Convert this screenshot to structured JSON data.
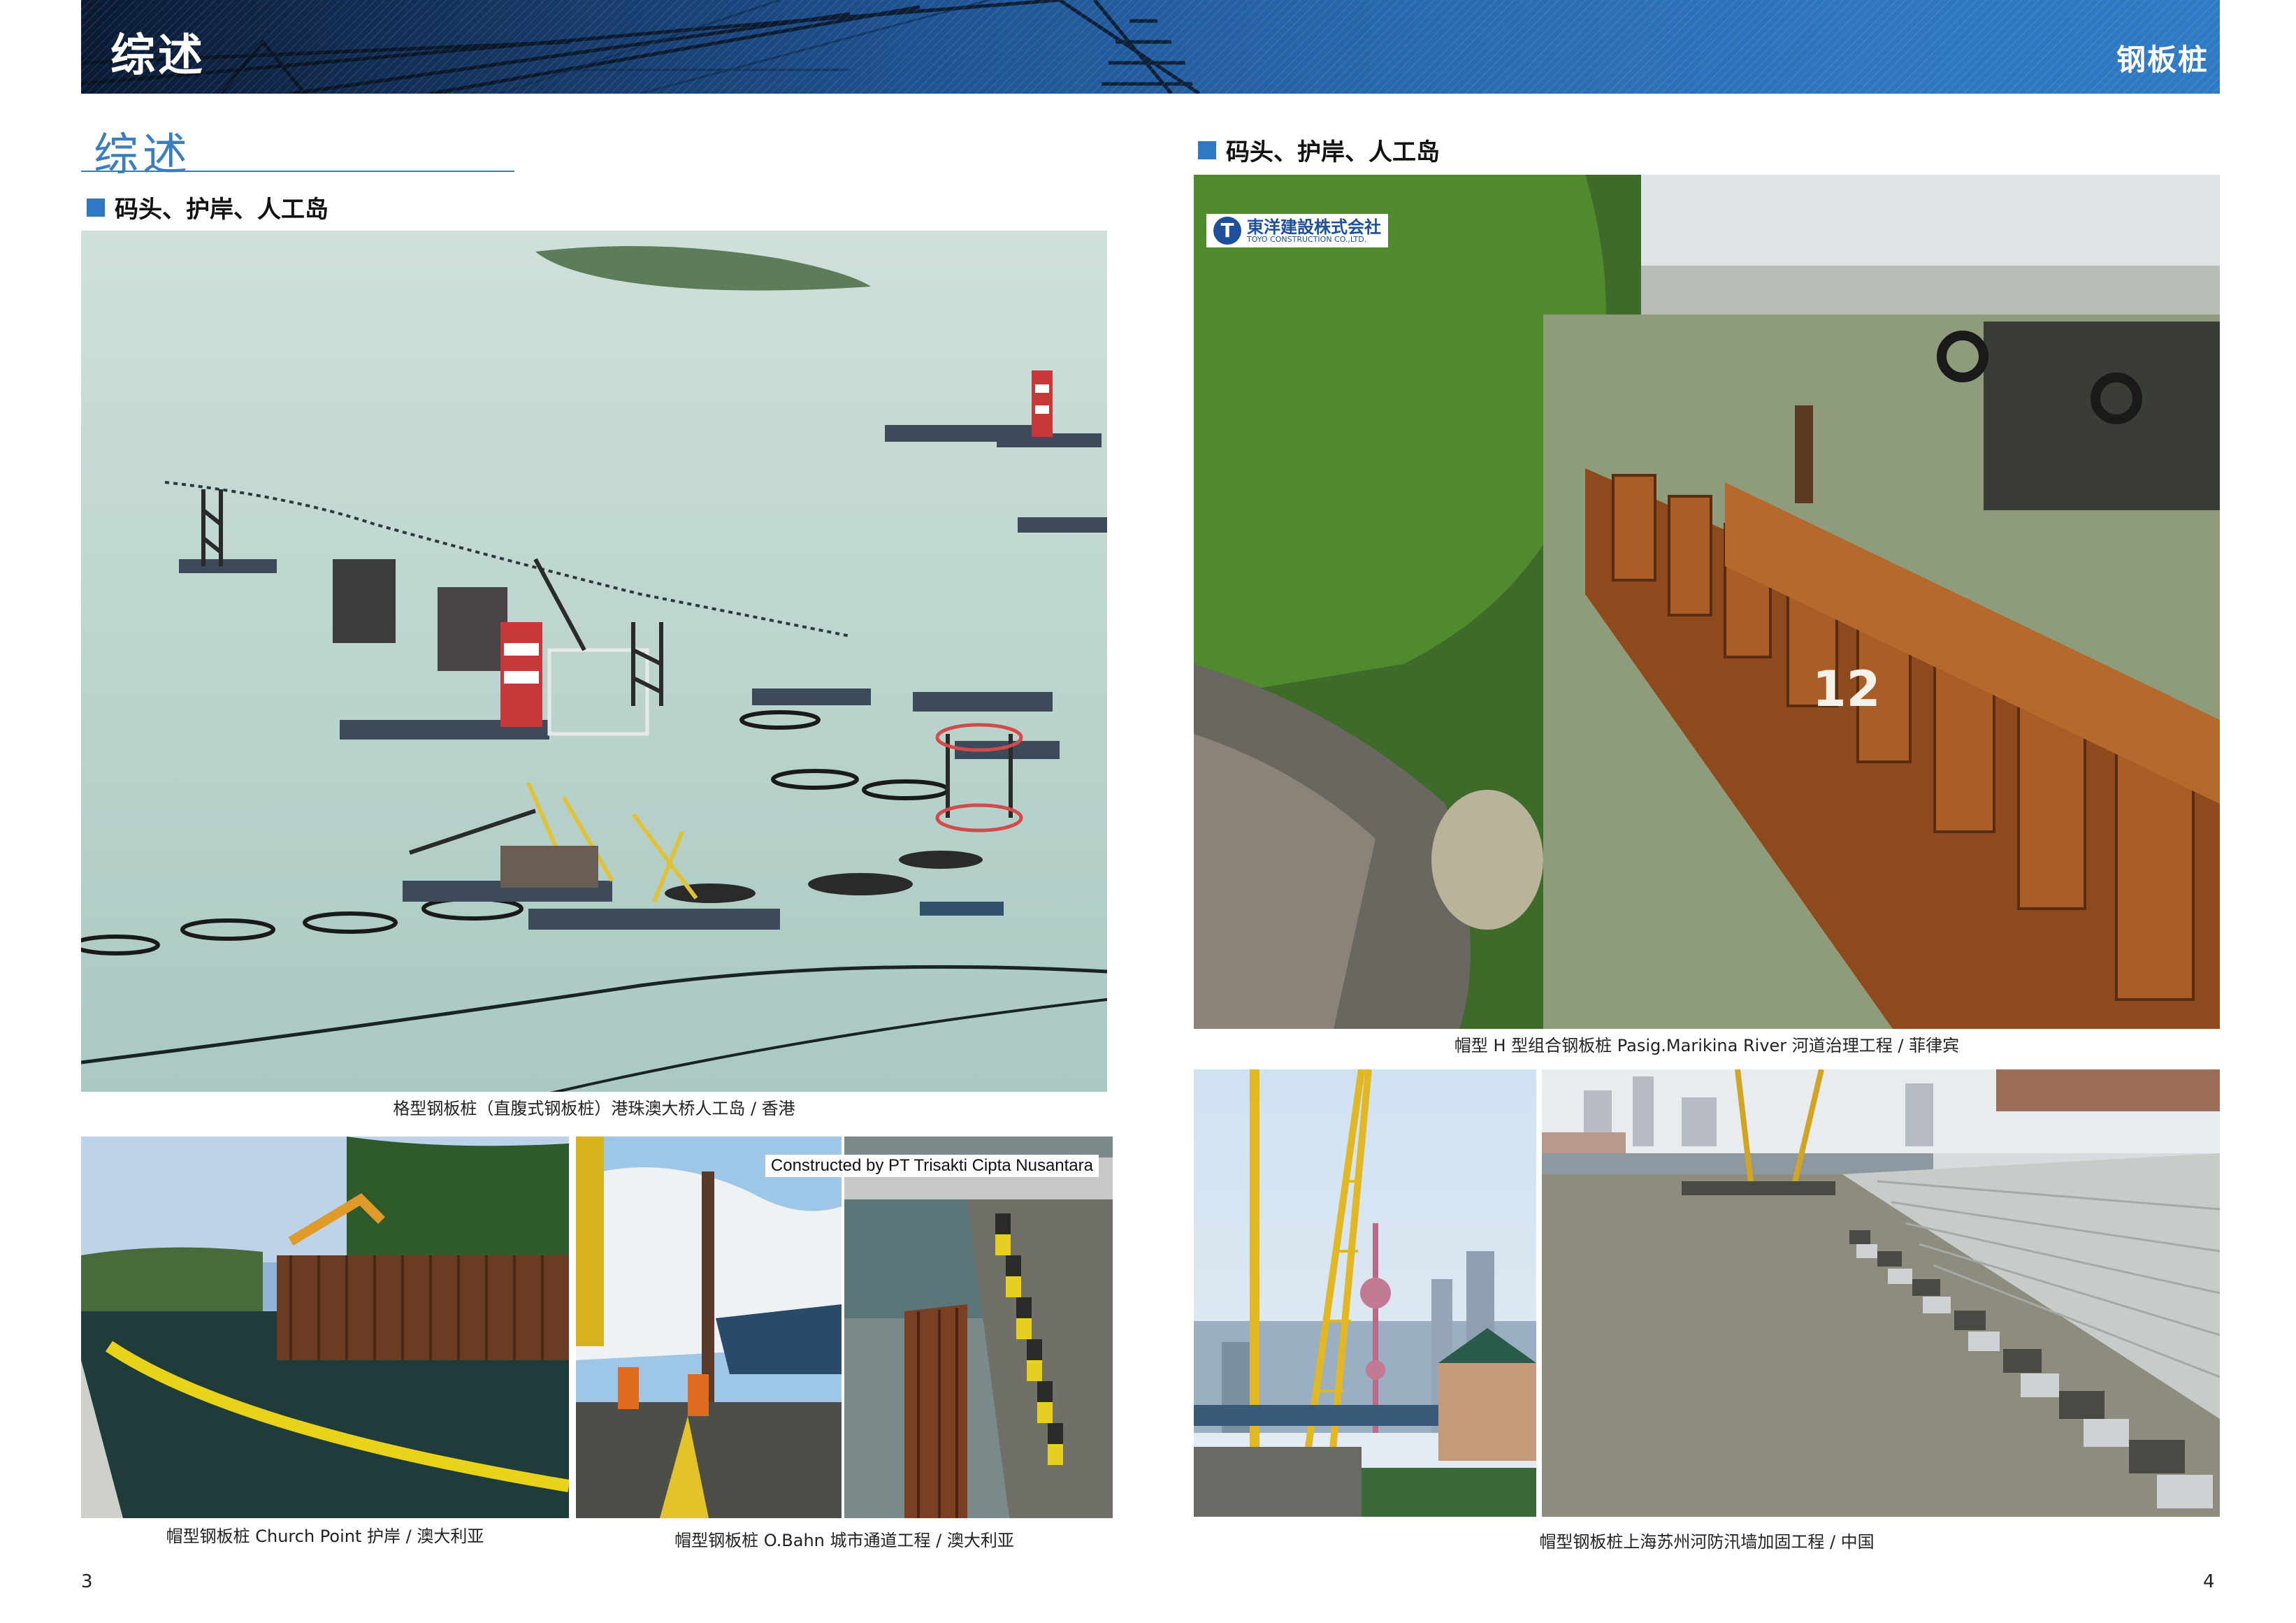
{
  "header": {
    "left_title": "综述",
    "right_title": "钢板桩"
  },
  "left_page": {
    "section_title": "综述",
    "subhead": "码头、护岸、人工岛",
    "main_caption": "格型钢板桩（直腹式钢板桩）港珠澳大桥人工岛 / 香港",
    "bottom_left_caption": "帽型钢板桩 Church Point 护岸 / 澳大利亚",
    "bottom_right_caption": "帽型钢板桩 O.Bahn 城市通道工程 / 澳大利亚",
    "photo_credit": "Constructed by PT Trisakti Cipta Nusantara",
    "page_number": "3"
  },
  "right_page": {
    "subhead": "码头、护岸、人工岛",
    "logo_text": "東洋建設株式会社",
    "logo_subtext": "TOYO CONSTRUCTION CO.,LTD.",
    "main_caption": "帽型 H 型组合钢板桩 Pasig.Marikina River 河道治理工程 / 菲律宾",
    "bottom_caption": "帽型钢板桩上海苏州河防汛墙加固工程 / 中国",
    "pile_marking": "12",
    "page_number": "4"
  },
  "colors": {
    "accent_blue": "#2f78c4",
    "band_dark": "#0a1a33",
    "band_light": "#2f7ac3"
  }
}
